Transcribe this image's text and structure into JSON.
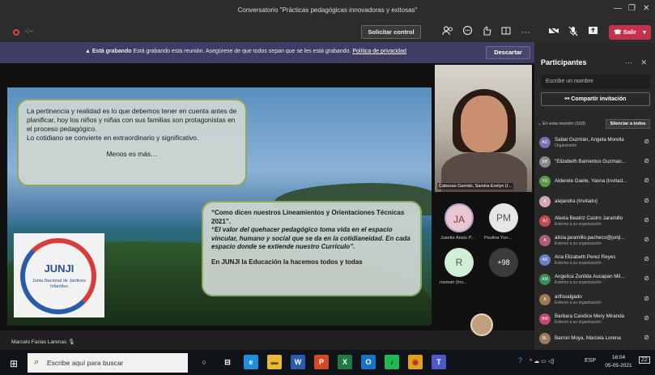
{
  "window": {
    "title": "Conversatorio \"Prácticas pedagógicas innovadoras y exitosas\"",
    "minimize": "—",
    "maximize": "❐",
    "close": "✕"
  },
  "toolbar": {
    "timer": "-:--",
    "request_control": "Solicitar control",
    "leave_label": "Salir",
    "leave_chevron": "▾"
  },
  "banner": {
    "icon": "▲",
    "strong": "Está grabando",
    "text": " Está grabando esta reunión. Asegúrese de que todos sepan que se les está grabando. ",
    "link": "Política de privacidad",
    "dismiss": "Descartar"
  },
  "slide": {
    "bubble1_text": "La pertinencia y realidad es lo que debemos tener en cuenta antes de planificar, hoy los niños y niñas con sus familias son protagonistas en el proceso pedagógico.\nLo cotidiano se convierte en extraordinario y significativo.",
    "bubble1_tag": "Menos es más…",
    "bubble2_quote": "“Como dicen nuestros Lineamientos y Orientaciones Técnicas 2021”.",
    "bubble2_italic": "“El valor del quehacer pedagógico toma vida en el espacio vincular, humano y social que se da en la cotidianeidad. En cada espacio donde se extiende nuestro Currículo”.",
    "bubble2_last": "En JUNJI la Educación la hacemos todos y todas",
    "logo_title": "JUNJI",
    "logo_sub": "Junta Nacional de Jardines Infantiles"
  },
  "presenter_name": "Marcelo Farias Larenas",
  "video": {
    "name": "Cabezas Garrido, Sandra Evelyn (I..."
  },
  "gallery": [
    {
      "initials": "JA",
      "label": "Jusette Anaís P...",
      "bg": "#e8c7d0",
      "fg": "#8b2a4a"
    },
    {
      "initials": "PM",
      "label": "Paulina Yurr...",
      "bg": "#e6e6e6",
      "fg": "#555555"
    },
    {
      "initials": "R",
      "label": "rosmari (Inv...",
      "bg": "#d3eed6",
      "fg": "#2a6b3a"
    },
    {
      "initials": "+98",
      "label": "",
      "bg": "#3b3b3b",
      "fg": "#ffffff"
    }
  ],
  "panel": {
    "title": "Participantes",
    "more": "···",
    "close": "✕",
    "search_placeholder": "Escribe un nombre",
    "share": "Compartir invitación",
    "section": "⌄ En esta reunión (103)",
    "mute_all": "Silenciar a todos",
    "participants": [
      {
        "initials": "AG",
        "name": "Sabat Guzmán, Angela Morella",
        "role": "Organizador",
        "color": "#7a6fb2"
      },
      {
        "initials": "EB",
        "name": "\"Elizabeth Barrientos Guzman...",
        "role": "",
        "color": "#888888"
      },
      {
        "initials": "YG",
        "name": "Alderete Gaete, Yasna (Invitad...",
        "role": "",
        "color": "#5a9a4a"
      },
      {
        "initials": "A",
        "name": "alejandra (Invitado)",
        "role": "",
        "color": "#d0a8b8"
      },
      {
        "initials": "AJ",
        "name": "Alexia Beatriz Castro Jaramillo",
        "role": "Externo a su organización",
        "color": "#c44a5a"
      },
      {
        "initials": "A",
        "name": "alicia.jaramillo.pacheco@junji...",
        "role": "Externo a su organización",
        "color": "#b05a80"
      },
      {
        "initials": "AR",
        "name": "Ana Elizabeth Perez Reyes",
        "role": "Externo a su organización",
        "color": "#6a80c0"
      },
      {
        "initials": "AM",
        "name": "Angelica Zunilda Aucapan Mil...",
        "role": "Externo a su organización",
        "color": "#3a8a5a"
      },
      {
        "initials": "A",
        "name": "arifosalgado",
        "role": "Externo a su organización",
        "color": "#9a7a50"
      },
      {
        "initials": "BM",
        "name": "Barbara Candice Mery Miranda",
        "role": "Externo a su organización",
        "color": "#c04a6a"
      },
      {
        "initials": "BL",
        "name": "Barron Moya, Marcela Lorena",
        "role": "",
        "color": "#a07a60"
      }
    ]
  },
  "taskbar": {
    "start": "⊞",
    "search": "Escribe aquí para buscar",
    "apps": [
      {
        "glyph": "○",
        "bg": "transparent",
        "fg": "#ffffff"
      },
      {
        "glyph": "⊟",
        "bg": "transparent",
        "fg": "#ffffff"
      },
      {
        "glyph": "e",
        "bg": "#1d8fe0",
        "fg": "#ffffff"
      },
      {
        "glyph": "▬",
        "bg": "#e8b83a",
        "fg": "#6a4a10"
      },
      {
        "glyph": "W",
        "bg": "#2b5cb4",
        "fg": "#ffffff"
      },
      {
        "glyph": "P",
        "bg": "#d04a2a",
        "fg": "#ffffff"
      },
      {
        "glyph": "X",
        "bg": "#21794a",
        "fg": "#ffffff"
      },
      {
        "glyph": "O",
        "bg": "#1872c8",
        "fg": "#ffffff"
      },
      {
        "glyph": "♪",
        "bg": "#1db954",
        "fg": "#000000"
      },
      {
        "glyph": "◉",
        "bg": "#e0a020",
        "fg": "#c02a2a"
      },
      {
        "glyph": "T",
        "bg": "#5059c9",
        "fg": "#ffffff"
      }
    ],
    "tray": "^ ☁ ▭ ◁)",
    "lang": "ESP",
    "time": "16:04",
    "date": "05-05-2021",
    "notifications": "22"
  }
}
